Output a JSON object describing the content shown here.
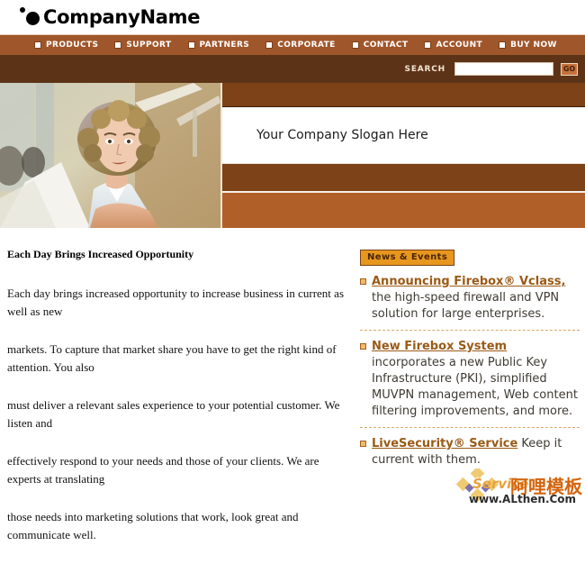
{
  "brand": {
    "name": "CompanyName",
    "logo_icon": "two-dots-logo-icon"
  },
  "nav": {
    "items": [
      {
        "label": "PRODUCTS",
        "bullet_icon": "square-bullet-icon"
      },
      {
        "label": "SUPPORT",
        "bullet_icon": "square-bullet-icon"
      },
      {
        "label": "PARTNERS",
        "bullet_icon": "square-bullet-icon"
      },
      {
        "label": "CORPORATE",
        "bullet_icon": "square-bullet-icon"
      },
      {
        "label": "CONTACT",
        "bullet_icon": "square-bullet-icon"
      },
      {
        "label": "ACCOUNT",
        "bullet_icon": "square-bullet-icon"
      },
      {
        "label": "BUY NOW",
        "bullet_icon": "square-bullet-icon"
      }
    ]
  },
  "search": {
    "label": "SEARCH",
    "value": "",
    "placeholder": "",
    "button_label": "GO"
  },
  "hero": {
    "photo_alt": "businesswoman-in-office-photo",
    "slogan": "Your Company Slogan Here"
  },
  "main": {
    "heading": "Each Day Brings Increased Opportunity",
    "paragraphs": [
      "Each day brings increased opportunity to increase business in current as well as new",
      "markets. To capture that market share you have to get the right kind of attention. You also",
      "must deliver a relevant sales experience to your potential customer. We listen and",
      "effectively respond to your needs and those of your clients. We are experts at translating",
      "those needs into marketing solutions that work, look great and communicate well."
    ]
  },
  "sidebar": {
    "badge": "News & Events",
    "items": [
      {
        "link": "Announcing Firebox® Vclass,",
        "text": " the high-speed firewall and VPN solution for large enterprises.",
        "bullet_icon": "square-bullet-icon"
      },
      {
        "link": "New Firebox System",
        "text": " incorporates a new Public Key Infrastructure (PKI), simplified MUVPN management, Web content filtering improvements, and more.",
        "bullet_icon": "square-bullet-icon"
      },
      {
        "link": "LiveSecurity® Service",
        "text": " Keep it current with them.",
        "bullet_icon": "square-bullet-icon"
      }
    ]
  },
  "watermark": {
    "chinese": "阿哩模板",
    "service": "Service",
    "url": "www.ALthen.Com",
    "icon": "diamond-cluster-icon"
  },
  "colors": {
    "nav_bar": "#a0562b",
    "search_band": "#5d3317",
    "band_dark": "#7d4218",
    "band_light": "#b05f28",
    "badge_orange": "#e8971e",
    "link_brown": "#9a5a16"
  }
}
